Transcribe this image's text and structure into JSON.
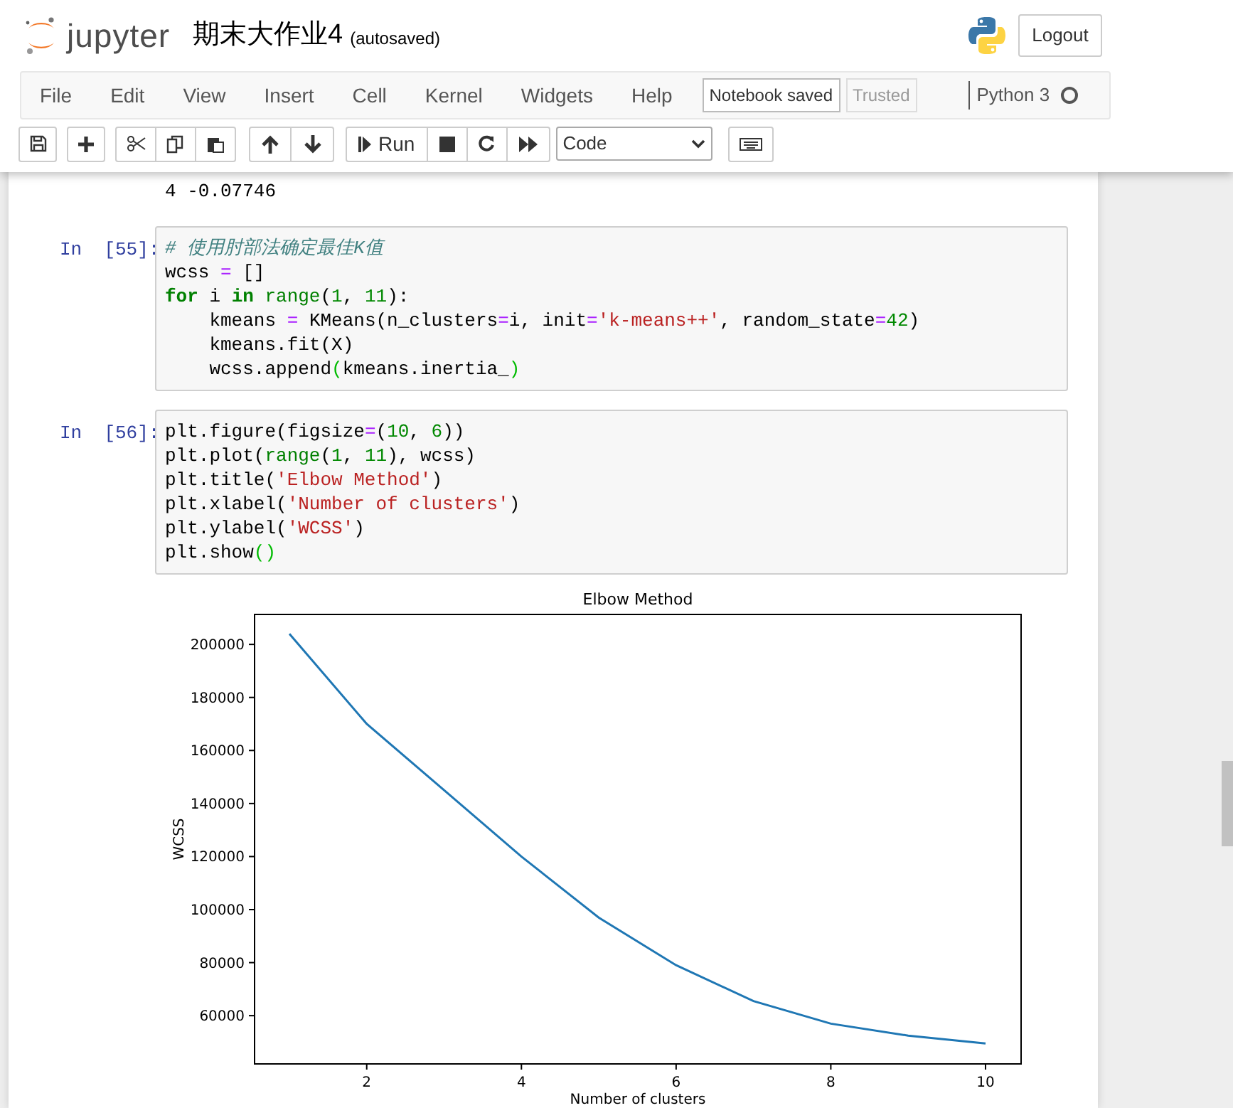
{
  "header": {
    "logo_text": "jupyter",
    "notebook_title": "期末大作业4",
    "save_status": "(autosaved)",
    "logout_label": "Logout"
  },
  "menu": {
    "items": [
      "File",
      "Edit",
      "View",
      "Insert",
      "Cell",
      "Kernel",
      "Widgets",
      "Help"
    ],
    "notebook_status": "Notebook saved",
    "trusted": {
      "label": "Trusted",
      "active": false
    },
    "kernel": {
      "name": "Python 3",
      "busy": false
    }
  },
  "toolbar": {
    "run_label": "Run",
    "cell_type": "Code"
  },
  "output_tail": [
    "4 -0.07746"
  ],
  "cells": [
    {
      "prompt": "In  [55]:",
      "lines": [
        [
          {
            "kind": "comment",
            "text": "# 使用肘部法确定最佳K值"
          }
        ],
        [
          {
            "kind": "plain",
            "text": "wcss "
          },
          {
            "kind": "operator",
            "text": "="
          },
          {
            "kind": "plain",
            "text": " []"
          }
        ],
        [
          {
            "kind": "keyword",
            "text": "for"
          },
          {
            "kind": "plain",
            "text": " i "
          },
          {
            "kind": "keyword",
            "text": "in"
          },
          {
            "kind": "builtin",
            "text": " range"
          },
          {
            "kind": "plain",
            "text": "("
          },
          {
            "kind": "number",
            "text": "1"
          },
          {
            "kind": "plain",
            "text": ", "
          },
          {
            "kind": "number",
            "text": "11"
          },
          {
            "kind": "plain",
            "text": "):"
          }
        ],
        [
          {
            "kind": "plain",
            "text": "    kmeans "
          },
          {
            "kind": "operator",
            "text": "="
          },
          {
            "kind": "plain",
            "text": " KMeans(n_clusters"
          },
          {
            "kind": "operator",
            "text": "="
          },
          {
            "kind": "plain",
            "text": "i, init"
          },
          {
            "kind": "operator",
            "text": "="
          },
          {
            "kind": "string",
            "text": "'k-means++'"
          },
          {
            "kind": "plain",
            "text": ", random_state"
          },
          {
            "kind": "operator",
            "text": "="
          },
          {
            "kind": "number",
            "text": "42"
          },
          {
            "kind": "plain",
            "text": ")"
          }
        ],
        [
          {
            "kind": "plain",
            "text": "    kmeans.fit(X)"
          }
        ],
        [
          {
            "kind": "plain",
            "text": "    wcss.append"
          },
          {
            "kind": "bracket",
            "text": "("
          },
          {
            "kind": "plain",
            "text": "kmeans.inertia_"
          },
          {
            "kind": "bracket",
            "text": ")"
          }
        ]
      ]
    },
    {
      "prompt": "In  [56]:",
      "lines": [
        [
          {
            "kind": "plain",
            "text": "plt.figure(figsize"
          },
          {
            "kind": "operator",
            "text": "="
          },
          {
            "kind": "plain",
            "text": "("
          },
          {
            "kind": "number",
            "text": "10"
          },
          {
            "kind": "plain",
            "text": ", "
          },
          {
            "kind": "number",
            "text": "6"
          },
          {
            "kind": "plain",
            "text": "))"
          }
        ],
        [
          {
            "kind": "plain",
            "text": "plt.plot("
          },
          {
            "kind": "builtin",
            "text": "range"
          },
          {
            "kind": "plain",
            "text": "("
          },
          {
            "kind": "number",
            "text": "1"
          },
          {
            "kind": "plain",
            "text": ", "
          },
          {
            "kind": "number",
            "text": "11"
          },
          {
            "kind": "plain",
            "text": "), wcss)"
          }
        ],
        [
          {
            "kind": "plain",
            "text": "plt.title("
          },
          {
            "kind": "string",
            "text": "'Elbow Method'"
          },
          {
            "kind": "plain",
            "text": ")"
          }
        ],
        [
          {
            "kind": "plain",
            "text": "plt.xlabel("
          },
          {
            "kind": "string",
            "text": "'Number of clusters'"
          },
          {
            "kind": "plain",
            "text": ")"
          }
        ],
        [
          {
            "kind": "plain",
            "text": "plt.ylabel("
          },
          {
            "kind": "string",
            "text": "'WCSS'"
          },
          {
            "kind": "plain",
            "text": ")"
          }
        ],
        [
          {
            "kind": "plain",
            "text": "plt.show"
          },
          {
            "kind": "bracket",
            "text": "()"
          }
        ]
      ]
    }
  ],
  "figure": {
    "chart_data": {
      "type": "line",
      "title": "Elbow Method",
      "xlabel": "Number of clusters",
      "ylabel": "WCSS",
      "x": [
        1,
        2,
        3,
        4,
        5,
        6,
        7,
        8,
        9,
        10
      ],
      "series": [
        {
          "color": "#1f77b4",
          "values": [
            204000,
            170000,
            145000,
            120000,
            97000,
            79000,
            65500,
            57000,
            52500,
            49500
          ]
        }
      ],
      "xlim": [
        0.55,
        10.46
      ],
      "ylim": [
        41800,
        211300
      ],
      "xticks": [
        2,
        4,
        6,
        8,
        10
      ],
      "yticks": [
        60000,
        80000,
        100000,
        120000,
        140000,
        160000,
        180000,
        200000
      ]
    }
  }
}
